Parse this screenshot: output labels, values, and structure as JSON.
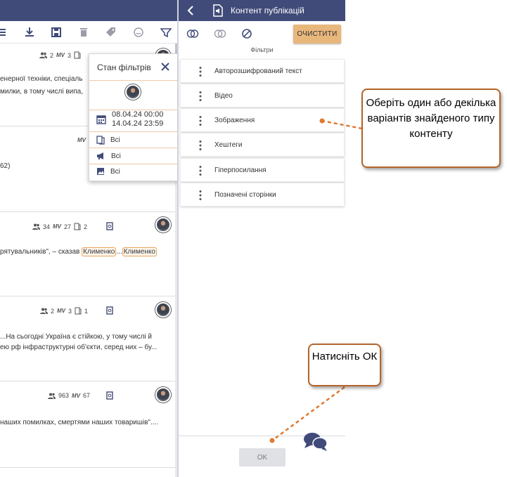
{
  "left_panel": {
    "cards": [
      {
        "stats": {
          "users": "2",
          "mv": "3"
        },
        "lines": [
          "енерної техніки, спеціаль",
          "милки, в тому числі випа,"
        ]
      },
      {
        "stats": {
          "mv": "MV"
        },
        "lines": [
          "62)"
        ]
      },
      {
        "stats": {
          "users": "34",
          "mv": "27",
          "docs": "2"
        },
        "line_prefix": " рятувальників\", – сказав ",
        "highlight_1": "Клименко",
        "dots": "...",
        "highlight_2": "Клименко"
      },
      {
        "stats": {
          "users": "2",
          "mv": "3",
          "docs": "1"
        },
        "lines": [
          "...На сьогодні Україна є стійкою, у тому числі й",
          "ею рф інфраструктурні об'єкти, серед них – бу..."
        ]
      },
      {
        "stats": {
          "users": "963",
          "mv": "67"
        },
        "lines": [
          " наших помилках, смертями наших товаришів\"...."
        ]
      }
    ],
    "mv_label": "MV",
    "filter_popup": {
      "title": "Стан фільтрів",
      "date_from": "08.04.24 00:00",
      "date_to": "14.04.24 23:59",
      "rows": [
        "Всі",
        "Всі",
        "Всі"
      ]
    }
  },
  "right_panel": {
    "header_title": "Контент публікацій",
    "clear_label": "ОЧИСТИТИ",
    "filters_label": "Фільтри",
    "filter_items": [
      "Авторозшифрований текст",
      "Відео",
      "Зображення",
      "Хештеги",
      "Гіперпосилання",
      "Позначені сторінки"
    ],
    "ok_label": "OK"
  },
  "callouts": {
    "choose_variants": "Оберіть один або декілька варіантів знайденого типу контенту",
    "press_ok": "Натисніть ОК"
  },
  "colors": {
    "header_bg": "#414b79",
    "accent": "#e8b77c",
    "callout_border": "#b5652a",
    "arrow": "#e07a30"
  }
}
